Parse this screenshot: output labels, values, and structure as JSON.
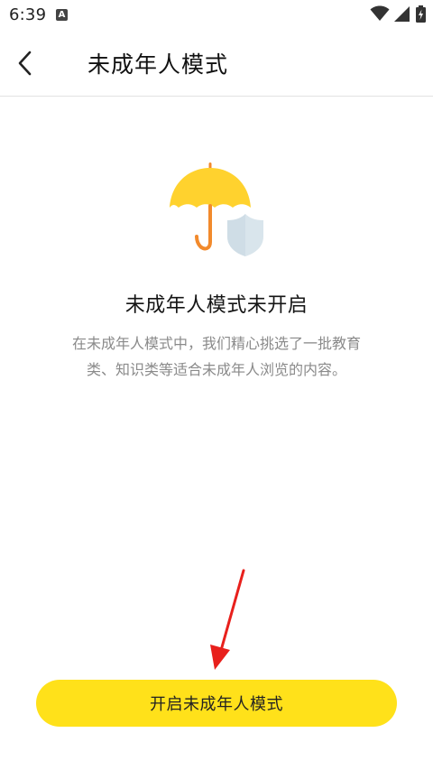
{
  "status_bar": {
    "time": "6:39",
    "notification_icon_letter": "A",
    "icons": [
      "wifi-icon",
      "signal-icon",
      "battery-charging-icon"
    ]
  },
  "header": {
    "back_icon": "chevron-left-icon",
    "title": "未成年人模式"
  },
  "main": {
    "illustration_icon": "umbrella-shield-icon",
    "heading": "未成年人模式未开启",
    "description_line1": "在未成年人模式中，我们精心挑选了一批教育",
    "description_line2": "类、知识类等适合未成年人浏览的内容。"
  },
  "footer": {
    "enable_button_label": "开启未成年人模式"
  },
  "colors": {
    "accent_yellow": "#ffe11a",
    "umbrella_yellow": "#ffd22e",
    "umbrella_handle": "#f28a2c",
    "shield": "#d9e5ec",
    "annotation_red": "#e8201c"
  }
}
